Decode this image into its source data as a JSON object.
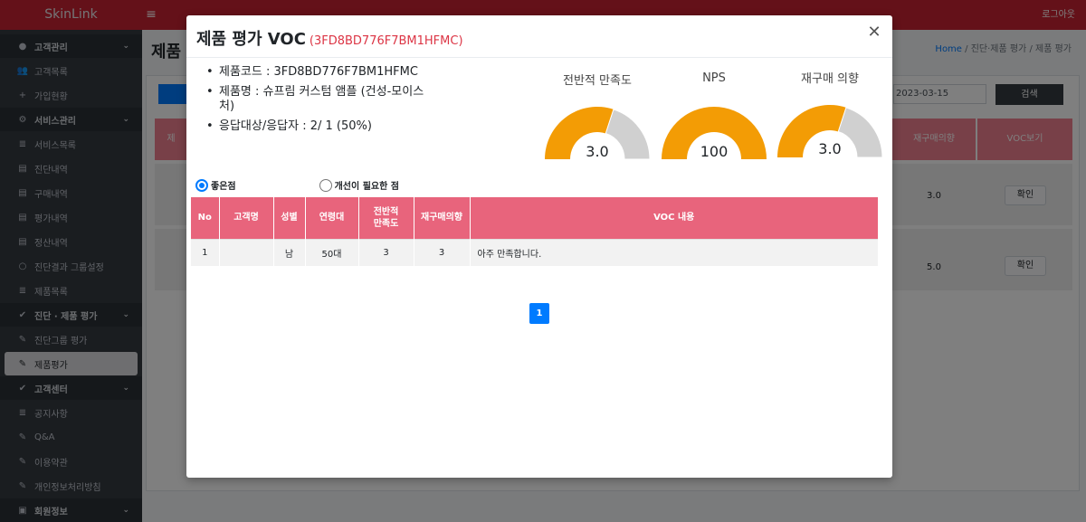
{
  "app": {
    "brand": "SkinLink",
    "logout": "로그아웃",
    "menu_icon": "hamburger-icon"
  },
  "sidebar": {
    "items": [
      {
        "label": "고객관리",
        "icon": "user-circle-icon",
        "type": "head"
      },
      {
        "label": "고객목록",
        "icon": "users-icon",
        "type": "item"
      },
      {
        "label": "가입현황",
        "icon": "user-plus-icon",
        "type": "item"
      },
      {
        "label": "서비스관리",
        "icon": "cogs-icon",
        "type": "head"
      },
      {
        "label": "서비스목록",
        "icon": "list-icon",
        "type": "item"
      },
      {
        "label": "진단내역",
        "icon": "copy-icon",
        "type": "item"
      },
      {
        "label": "구매내역",
        "icon": "copy-icon",
        "type": "item"
      },
      {
        "label": "평가내역",
        "icon": "copy-icon",
        "type": "item"
      },
      {
        "label": "정산내역",
        "icon": "copy-icon",
        "type": "item"
      },
      {
        "label": "진단결과 그룹설정",
        "icon": "circle-icon",
        "type": "item"
      },
      {
        "label": "제품목록",
        "icon": "list-icon",
        "type": "item"
      },
      {
        "label": "진단 · 제품 평가",
        "icon": "check-circle-icon",
        "type": "head"
      },
      {
        "label": "진단그룹 평가",
        "icon": "edit-icon",
        "type": "item"
      },
      {
        "label": "제품평가",
        "icon": "edit-icon",
        "type": "active"
      },
      {
        "label": "고객센터",
        "icon": "check-circle-icon",
        "type": "head"
      },
      {
        "label": "공지사항",
        "icon": "list-icon",
        "type": "item"
      },
      {
        "label": "Q&A",
        "icon": "edit-icon",
        "type": "item"
      },
      {
        "label": "이용약관",
        "icon": "edit-icon",
        "type": "item"
      },
      {
        "label": "개인정보처리방침",
        "icon": "edit-icon",
        "type": "item"
      },
      {
        "label": "회원정보",
        "icon": "id-card-icon",
        "type": "head"
      }
    ]
  },
  "page": {
    "title": "제품",
    "breadcrumb": {
      "home": "Home",
      "level1": "진단·제품 평가",
      "level2": "제품 평가"
    },
    "date_value": "2023-03-15",
    "search_label": "검색",
    "headers": {
      "col_left": "제",
      "repurchase": "재구매의향",
      "voc_view": "VOC보기"
    },
    "rows": [
      {
        "repurchase": "3.0",
        "action": "확인"
      },
      {
        "repurchase": "5.0",
        "action": "확인"
      }
    ]
  },
  "modal": {
    "title": "제품 평가 VOC",
    "title_code": "(3FD8BD776F7BM1HFMC)",
    "info": {
      "product_code": "제품코드 : 3FD8BD776F7BM1HFMC",
      "product_name": "제품명 : 슈프림 커스텀 앰플 (건성-모이스처)",
      "respondents": "응답대상/응답자 : 2/ 1 (50%)"
    },
    "gauges": [
      {
        "label": "전반적 만족도",
        "value_text": "3.0",
        "value": 3.0,
        "max": 5
      },
      {
        "label": "NPS",
        "value_text": "100",
        "value": 100,
        "max": 100
      },
      {
        "label": "재구매 의향",
        "value_text": "3.0",
        "value": 3.0,
        "max": 5
      }
    ],
    "colors": {
      "fill": "#f39c05",
      "rest": "#d0d0d0",
      "header": "#e8647c"
    },
    "filter": {
      "good": "좋은점",
      "improve": "개선이 필요한 점",
      "selected": "good"
    },
    "table": {
      "headers": [
        "No",
        "고객명",
        "성별",
        "연령대",
        "전반적 만족도",
        "재구매의향",
        "VOC 내용"
      ],
      "rows": [
        [
          "1",
          "",
          "남",
          "50대",
          "3",
          "3",
          "아주 만족합니다."
        ]
      ]
    },
    "pagination": {
      "current": "1"
    }
  }
}
